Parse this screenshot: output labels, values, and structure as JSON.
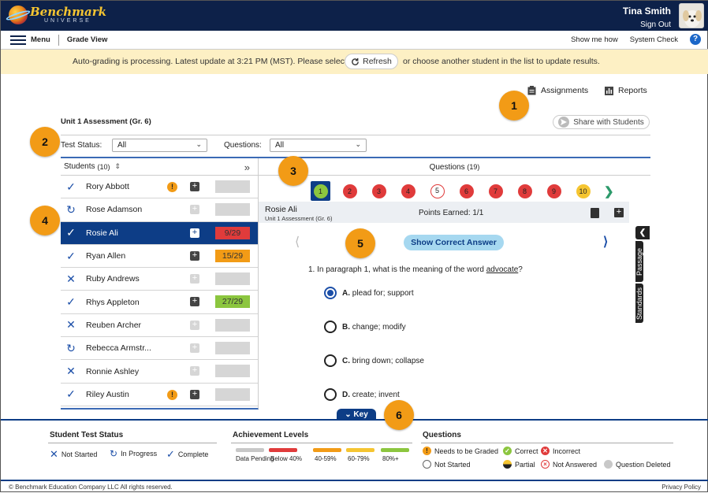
{
  "header": {
    "logo_text": "Benchmark",
    "logo_sub": "UNIVERSE",
    "user_name": "Tina Smith",
    "sign_out": "Sign Out"
  },
  "menubar": {
    "menu": "Menu",
    "grade_view": "Grade View",
    "show_me_how": "Show me how",
    "system_check": "System Check",
    "help": "?"
  },
  "banner": {
    "text_before": "Auto-grading is processing. Latest update at 3:21 PM (MST). Please select",
    "refresh": "Refresh",
    "text_after": "or choose another student in the list to update results."
  },
  "toolbar": {
    "assignments": "Assignments",
    "reports": "Reports",
    "share": "Share with Students"
  },
  "assessment_title": "Unit 1 Assessment (Gr. 6)",
  "filters": {
    "test_status_label": "Test Status:",
    "test_status_value": "All",
    "questions_label": "Questions:",
    "questions_value": "All"
  },
  "callouts": [
    "1",
    "2",
    "3",
    "4",
    "5",
    "6"
  ],
  "students": {
    "header": "Students",
    "count": "(10)",
    "rows": [
      {
        "name": "Rory Abbott",
        "status": "complete",
        "flag": true,
        "score": "",
        "score_color": "#d6d6d6",
        "note_faint": false
      },
      {
        "name": "Rose Adamson",
        "status": "in-progress",
        "flag": false,
        "score": "",
        "score_color": "#d6d6d6",
        "note_faint": true
      },
      {
        "name": "Rosie Ali",
        "status": "complete",
        "flag": false,
        "score": "9/29",
        "score_color": "#e03b3b",
        "note_faint": false,
        "selected": true
      },
      {
        "name": "Ryan Allen",
        "status": "complete",
        "flag": false,
        "score": "15/29",
        "score_color": "#f29b16",
        "note_faint": false
      },
      {
        "name": "Ruby Andrews",
        "status": "not-started",
        "flag": false,
        "score": "",
        "score_color": "#d6d6d6",
        "note_faint": true
      },
      {
        "name": "Rhys Appleton",
        "status": "complete",
        "flag": false,
        "score": "27/29",
        "score_color": "#8cc63f",
        "note_faint": false
      },
      {
        "name": "Reuben Archer",
        "status": "not-started",
        "flag": false,
        "score": "",
        "score_color": "#d6d6d6",
        "note_faint": true
      },
      {
        "name": "Rebecca Armstr...",
        "status": "in-progress",
        "flag": false,
        "score": "",
        "score_color": "#d6d6d6",
        "note_faint": true
      },
      {
        "name": "Ronnie Ashley",
        "status": "not-started",
        "flag": false,
        "score": "",
        "score_color": "#d6d6d6",
        "note_faint": true
      },
      {
        "name": "Riley Austin",
        "status": "complete",
        "flag": true,
        "score": "",
        "score_color": "#d6d6d6",
        "note_faint": false
      }
    ]
  },
  "questions": {
    "header": "Questions",
    "count": "(19)",
    "numbers": [
      {
        "n": "1",
        "state": "correct",
        "active": true
      },
      {
        "n": "2",
        "state": "incorrect"
      },
      {
        "n": "3",
        "state": "incorrect"
      },
      {
        "n": "4",
        "state": "incorrect"
      },
      {
        "n": "5",
        "state": "notans"
      },
      {
        "n": "6",
        "state": "incorrect"
      },
      {
        "n": "7",
        "state": "incorrect"
      },
      {
        "n": "8",
        "state": "incorrect"
      },
      {
        "n": "9",
        "state": "incorrect"
      },
      {
        "n": "10",
        "state": "partial"
      }
    ],
    "student_name": "Rosie Ali",
    "assessment": "Unit 1 Assessment (Gr. 6)",
    "points_earned": "Points Earned: 1/1",
    "show_correct": "Show Correct Answer",
    "question_prefix": "1. In paragraph 1, what is the meaning of the word",
    "question_word": "advocate",
    "question_suffix": "?",
    "options": [
      {
        "letter": "A.",
        "text": "plead for; support",
        "selected": true
      },
      {
        "letter": "B.",
        "text": "change; modify"
      },
      {
        "letter": "C.",
        "text": "bring down; collapse"
      },
      {
        "letter": "D.",
        "text": "create; invent"
      }
    ],
    "side_tabs": [
      "Passage",
      "Standards"
    ]
  },
  "key": {
    "tab": "Key",
    "status_title": "Student Test Status",
    "not_started": "Not Started",
    "in_progress": "In Progress",
    "complete": "Complete",
    "achievement_title": "Achievement Levels",
    "levels": [
      {
        "label": "Data Pending",
        "color": "#c8c8c8"
      },
      {
        "label": "Below 40%",
        "color": "#e03b3b"
      },
      {
        "label": "40-59%",
        "color": "#f29b16"
      },
      {
        "label": "60-79%",
        "color": "#f5c531"
      },
      {
        "label": "80%+",
        "color": "#8cc63f"
      }
    ],
    "questions_title": "Questions",
    "needs_graded": "Needs to be Graded",
    "correct": "Correct",
    "incorrect": "Incorrect",
    "not_started_q": "Not Started",
    "partial": "Partial",
    "not_answered": "Not Answered",
    "deleted": "Question Deleted"
  },
  "footer": {
    "copyright": "© Benchmark Education Company LLC All rights reserved.",
    "privacy": "Privacy Policy"
  }
}
